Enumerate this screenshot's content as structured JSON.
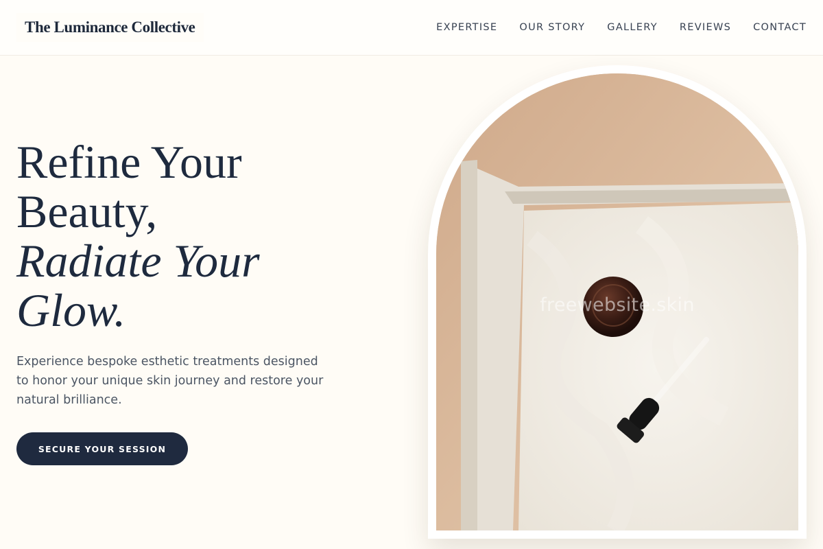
{
  "brand": {
    "name": "The Luminance Collective"
  },
  "nav": {
    "items": [
      {
        "label": "EXPERTISE"
      },
      {
        "label": "OUR STORY"
      },
      {
        "label": "GALLERY"
      },
      {
        "label": "REVIEWS"
      },
      {
        "label": "CONTACT"
      }
    ]
  },
  "hero": {
    "title_line1": "Refine Your",
    "title_line2": "Beauty,",
    "title_italic1": "Radiate Your",
    "title_italic2": "Glow.",
    "subtitle": "Experience bespoke esthetic treatments designed to honor your unique skin journey and restore your natural brilliance.",
    "cta_label": "SECURE YOUR SESSION"
  },
  "image": {
    "watermark": "freewebsite.skin",
    "subject": "skincare-bottles-on-towel-photo"
  },
  "colors": {
    "background": "#fffcf6",
    "primary": "#1f2a3f",
    "text": "#1e2a3e",
    "muted": "#4b5563"
  }
}
